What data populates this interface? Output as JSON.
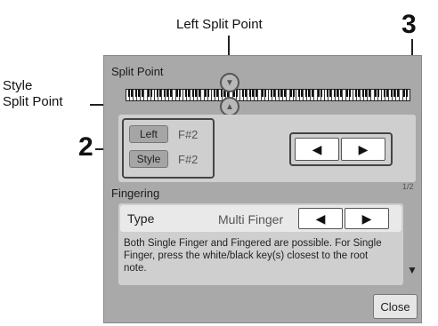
{
  "callouts": {
    "left_split_point": "Left Split Point",
    "style_line1": "Style",
    "style_line2": "Split Point",
    "num2": "2",
    "num3": "3"
  },
  "split_point": {
    "title": "Split Point",
    "left_button": "Left",
    "left_value": "F#2",
    "style_button": "Style",
    "style_value": "F#2",
    "marker_icons": [
      "down-triangle",
      "up-triangle"
    ]
  },
  "page_indicator": "1/2",
  "fingering": {
    "title": "Fingering",
    "type_label": "Type",
    "type_value": "Multi Finger",
    "description": "Both Single Finger and Fingered are possible. For Single Finger, press the white/black key(s) closest to the root note."
  },
  "arrows": {
    "left": "◀",
    "right": "▶",
    "down": "▼"
  },
  "close_label": "Close"
}
